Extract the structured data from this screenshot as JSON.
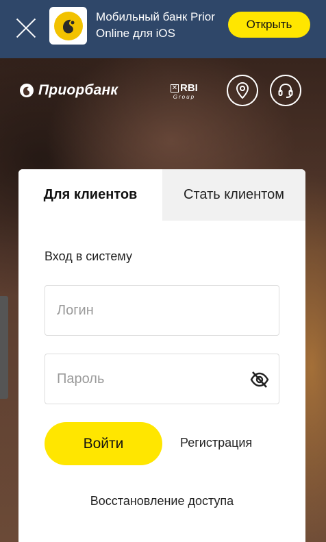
{
  "banner": {
    "close_icon": "close-icon",
    "app_icon": "prior-online-app-icon",
    "text_line1": "Мобильный банк Prior",
    "text_line2": "Online для iOS",
    "open_label": "Открыть"
  },
  "header": {
    "logo_text": "Приорбанк",
    "partner_logo_main": "RBI",
    "partner_logo_sub": "Group",
    "location_icon": "location-pin-icon",
    "support_icon": "headset-icon"
  },
  "card": {
    "tabs": [
      {
        "label": "Для клиентов",
        "active": true
      },
      {
        "label": "Стать клиентом",
        "active": false
      }
    ],
    "form_title": "Вход в систему",
    "login": {
      "placeholder": "Логин",
      "value": ""
    },
    "password": {
      "placeholder": "Пароль",
      "value": "",
      "toggle_icon": "eye-slash-icon"
    },
    "login_button": "Войти",
    "register_link": "Регистрация",
    "restore_link": "Восстановление доступа"
  },
  "colors": {
    "banner_bg": "#2f4769",
    "accent_yellow": "#ffe600",
    "inactive_tab_bg": "#f1f1f1"
  }
}
